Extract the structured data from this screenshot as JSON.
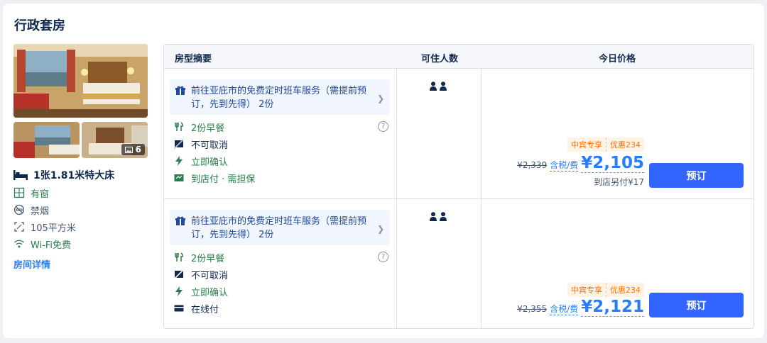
{
  "room": {
    "title": "行政套房",
    "photo_count": "6",
    "bed": "1张1.81米特大床",
    "features": [
      {
        "icon": "window-icon",
        "label": "有窗"
      },
      {
        "icon": "no-smoking-icon",
        "label": "禁烟"
      },
      {
        "icon": "area-icon",
        "label": "105平方米"
      },
      {
        "icon": "wifi-icon",
        "label": "Wi-Fi免费"
      }
    ],
    "detail_link": "房间详情"
  },
  "table": {
    "headers": {
      "summary": "房型摘要",
      "occupancy": "可住人数",
      "price": "今日价格"
    },
    "rows": [
      {
        "shuttle": "前往亚庇市的免费定时班车服务（需提前预订，先到先得） 2份",
        "breakfast": "2份早餐",
        "cancel": "不可取消",
        "confirm": "立即确认",
        "payment": "到店付 · 需担保",
        "occupancy": 2,
        "tag1": "中宾专享",
        "tag2": "优惠234",
        "original_price": "¥2,339",
        "tax_label": "含税/费",
        "price": "¥2,105",
        "extra_fee": "到店另付¥17",
        "button": "预订"
      },
      {
        "shuttle": "前往亚庇市的免费定时班车服务（需提前预订，先到先得） 2份",
        "breakfast": "2份早餐",
        "cancel": "不可取消",
        "confirm": "立即确认",
        "payment": "在线付",
        "occupancy": 2,
        "tag1": "中宾专享",
        "tag2": "优惠234",
        "original_price": "¥2,355",
        "tax_label": "含税/费",
        "price": "¥2,121",
        "extra_fee": "",
        "button": "预订"
      }
    ]
  },
  "colors": {
    "accent": "#287dfa",
    "button": "#3264ff",
    "green": "#287d4c",
    "promo": "#ff6f00"
  }
}
